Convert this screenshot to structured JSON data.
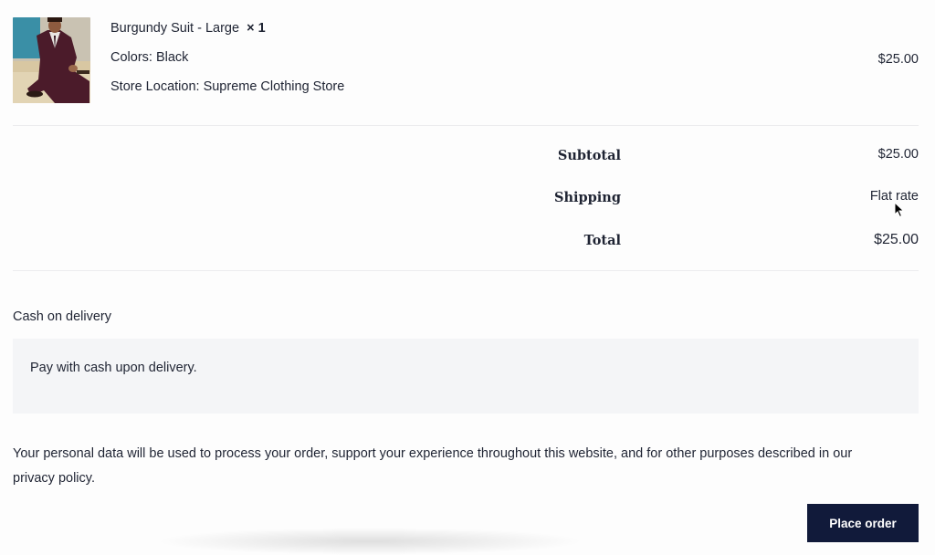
{
  "order_item": {
    "title": "Burgundy Suit - Large",
    "quantity": "× 1",
    "color": "Colors: Black",
    "store": "Store Location: Supreme Clothing Store",
    "price": "$25.00"
  },
  "totals": {
    "subtotal_label": "Subtotal",
    "subtotal_value": "$25.00",
    "shipping_label": "Shipping",
    "shipping_value": "Flat rate",
    "total_label": "Total",
    "total_value": "$25.00"
  },
  "payment": {
    "method": "Cash on delivery",
    "description": "Pay with cash upon delivery."
  },
  "privacy": {
    "text": "Your personal data will be used to process your order, support your experience throughout this website, and for other purposes described in our",
    "link": "privacy policy",
    "after_link": "."
  },
  "actions": {
    "place_order": "Place order"
  },
  "colors": {
    "button_bg": "#111a3a",
    "panel_bg": "#f4f5f7"
  }
}
